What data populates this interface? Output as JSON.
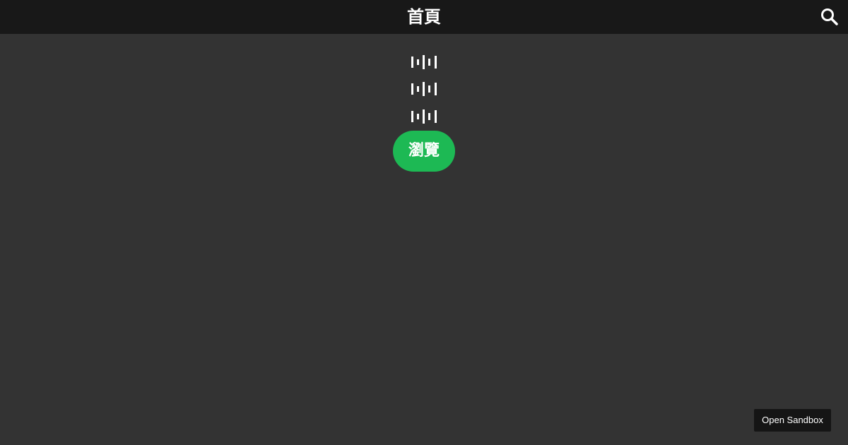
{
  "header": {
    "title": "首頁",
    "search_icon": "search-icon"
  },
  "content": {
    "audio_items": [
      {
        "icon": "audio-waveform-icon"
      },
      {
        "icon": "audio-waveform-icon"
      },
      {
        "icon": "audio-waveform-icon"
      }
    ],
    "browse_label": "瀏覽"
  },
  "footer": {
    "sandbox_label": "Open Sandbox"
  },
  "colors": {
    "background": "#333333",
    "topbar": "#181818",
    "accent": "#1db954",
    "text": "#ffffff"
  }
}
